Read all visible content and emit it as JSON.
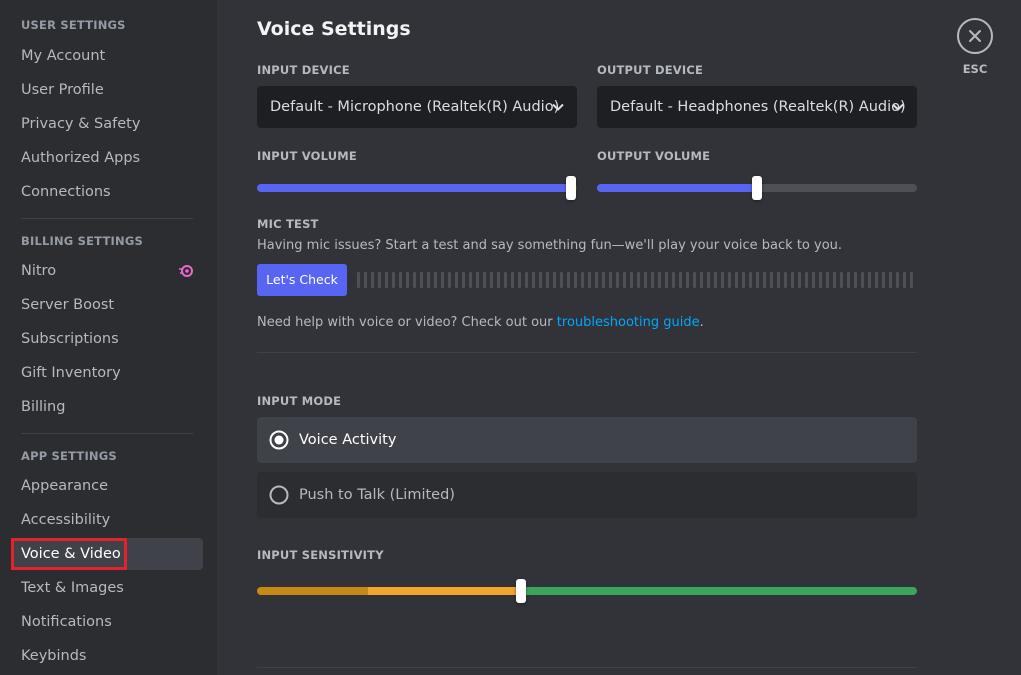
{
  "sidebar": {
    "user_settings_header": "USER SETTINGS",
    "user_items": [
      "My Account",
      "User Profile",
      "Privacy & Safety",
      "Authorized Apps",
      "Connections"
    ],
    "billing_header": "BILLING SETTINGS",
    "billing_items": [
      "Nitro",
      "Server Boost",
      "Subscriptions",
      "Gift Inventory",
      "Billing"
    ],
    "app_header": "APP SETTINGS",
    "app_items": [
      "Appearance",
      "Accessibility",
      "Voice & Video",
      "Text & Images",
      "Notifications",
      "Keybinds"
    ],
    "active_item": "Voice & Video",
    "nitro_icon": "nitro-icon"
  },
  "page": {
    "title": "Voice Settings",
    "close_label": "ESC",
    "close_icon": "close-icon"
  },
  "devices": {
    "input_label": "INPUT DEVICE",
    "input_value": "Default - Microphone (Realtek(R) Audio)",
    "output_label": "OUTPUT DEVICE",
    "output_value": "Default - Headphones (Realtek(R) Audio)"
  },
  "volume": {
    "input_label": "INPUT VOLUME",
    "input_level_percent": 98,
    "output_label": "OUTPUT VOLUME",
    "output_level_percent": 50
  },
  "mic_test": {
    "label": "MIC TEST",
    "description": "Having mic issues? Start a test and say something fun—we'll play your voice back to you.",
    "button": "Let's Check",
    "help_prefix": "Need help with voice or video? Check out our ",
    "help_link": "troubleshooting guide",
    "help_suffix": "."
  },
  "input_mode": {
    "label": "INPUT MODE",
    "options": [
      "Voice Activity",
      "Push to Talk (Limited)"
    ],
    "selected": "Voice Activity"
  },
  "sensitivity": {
    "label": "INPUT SENSITIVITY",
    "threshold_percent": 40
  },
  "colors": {
    "accent": "#5865f2",
    "link": "#00a8fc",
    "sens_low": "#c78a17",
    "sens_mid": "#f0a52c",
    "sens_high": "#3ba55c",
    "highlight": "#e3232c"
  }
}
